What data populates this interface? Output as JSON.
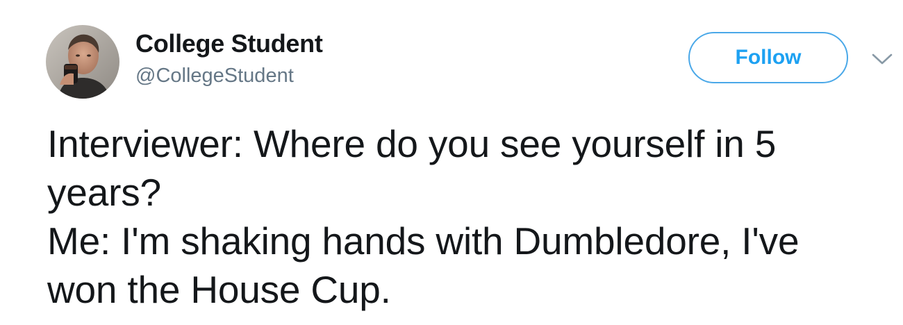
{
  "user": {
    "name": "College Student",
    "handle": "@CollegeStudent",
    "avatar_icon": "profile-photo-man-drinking"
  },
  "actions": {
    "follow_label": "Follow",
    "more_icon": "chevron-down-icon"
  },
  "tweet": {
    "lines": [
      "Interviewer: Where do you see yourself in 5",
      "years?",
      "Me: I'm shaking hands with Dumbledore, I've",
      "won the House Cup."
    ]
  },
  "colors": {
    "accent": "#1da1f2",
    "follow_border": "#4aa8e8",
    "text": "#14171a",
    "secondary_text": "#657786"
  }
}
